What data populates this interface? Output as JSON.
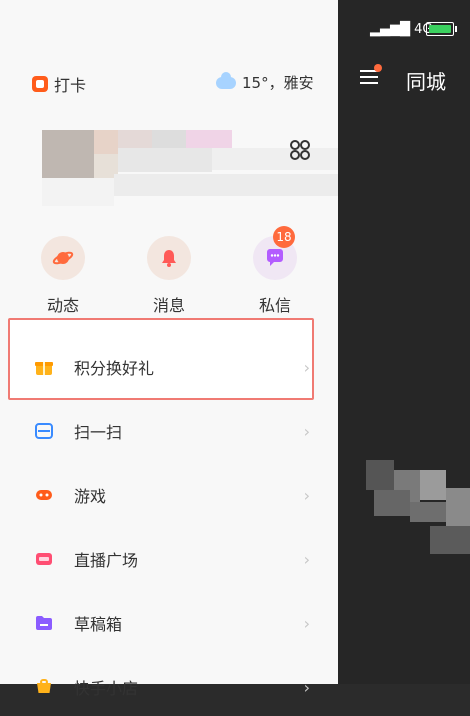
{
  "status": {
    "signal": "4G"
  },
  "right_panel": {
    "title": "同城"
  },
  "drawer": {
    "checkin": "打卡",
    "weather": "15°，雅安",
    "quick_actions": [
      {
        "label": "动态",
        "icon": "planet-icon"
      },
      {
        "label": "消息",
        "icon": "bell-icon"
      },
      {
        "label": "私信",
        "icon": "chat-icon",
        "badge": "18"
      }
    ],
    "items": [
      {
        "label": "积分换好礼",
        "icon": "gift-icon"
      },
      {
        "label": "扫一扫",
        "icon": "scan-icon"
      },
      {
        "label": "游戏",
        "icon": "game-icon"
      },
      {
        "label": "直播广场",
        "icon": "live-icon"
      },
      {
        "label": "草稿箱",
        "icon": "folder-icon"
      },
      {
        "label": "快手小店",
        "icon": "shop-icon"
      }
    ]
  },
  "colors": {
    "accent": "#ff5c1b",
    "highlight_border": "#f07a73",
    "panel_dark": "#262626"
  }
}
